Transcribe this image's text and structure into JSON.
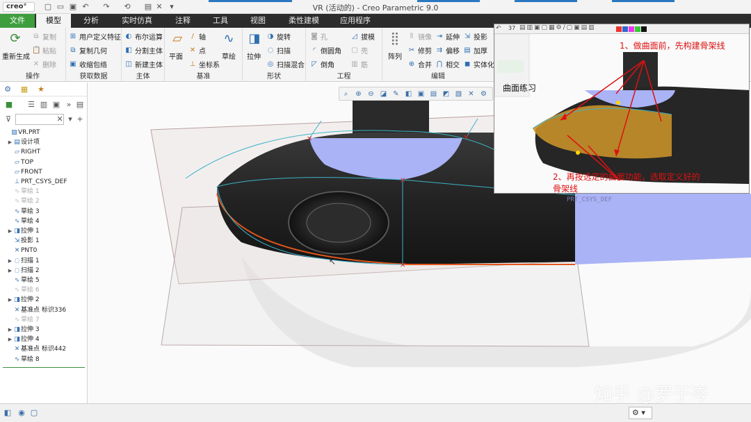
{
  "window": {
    "logo": "creo°",
    "title": "VR (活动的) - Creo Parametric 9.0"
  },
  "menu_tabs": [
    {
      "label": "文件",
      "active": false
    },
    {
      "label": "模型",
      "active": true
    },
    {
      "label": "分析"
    },
    {
      "label": "实时仿真"
    },
    {
      "label": "注释"
    },
    {
      "label": "工具"
    },
    {
      "label": "视图"
    },
    {
      "label": "柔性建模"
    },
    {
      "label": "应用程序"
    }
  ],
  "ribbon": {
    "operations": {
      "regen": "重新生成",
      "copy": "复制",
      "paste": "粘贴",
      "delete": "删除",
      "label": "操作"
    },
    "get_data": {
      "udf": "用户定义特征",
      "copy_geom": "复制几何",
      "shrinkwrap": "收缩包络",
      "label": "获取数据"
    },
    "body": {
      "boolean": "布尔运算",
      "split": "分割主体",
      "new_body": "新建主体",
      "label": "主体"
    },
    "datum": {
      "plane": "平面",
      "axis": "轴",
      "point": "点",
      "csys": "坐标系",
      "sketch": "草绘",
      "label": "基准"
    },
    "shapes": {
      "extrude": "拉伸",
      "revolve": "旋转",
      "sweep": "扫描",
      "swept_blend": "扫描混合",
      "label": "形状"
    },
    "engineering": {
      "hole": "孔",
      "round": "倒圆角",
      "chamfer": "倒角",
      "draft": "拔模",
      "shell": "壳",
      "rib": "筋",
      "label": "工程"
    },
    "editing": {
      "pattern": "阵列",
      "mirror": "镜像",
      "trim": "修剪",
      "merge": "合并",
      "extend": "延伸",
      "offset": "偏移",
      "intersect": "相交",
      "project": "投影",
      "thicken": "加厚",
      "solidify": "实体化",
      "label": "编辑"
    }
  },
  "model_tree": {
    "items": [
      {
        "label": "VR.PRT",
        "icon": "part-icon",
        "expandable": false,
        "suppressed": false,
        "indent": 0
      },
      {
        "label": "设计项",
        "icon": "design-items-icon",
        "expandable": true,
        "suppressed": false,
        "indent": 1
      },
      {
        "label": "RIGHT",
        "icon": "datum-plane-icon",
        "expandable": false,
        "suppressed": false,
        "indent": 1
      },
      {
        "label": "TOP",
        "icon": "datum-plane-icon",
        "expandable": false,
        "suppressed": false,
        "indent": 1
      },
      {
        "label": "FRONT",
        "icon": "datum-plane-icon",
        "expandable": false,
        "suppressed": false,
        "indent": 1
      },
      {
        "label": "PRT_CSYS_DEF",
        "icon": "csys-icon",
        "expandable": false,
        "suppressed": false,
        "indent": 1
      },
      {
        "label": "草绘 1",
        "icon": "sketch-icon",
        "expandable": false,
        "suppressed": true,
        "indent": 1
      },
      {
        "label": "草绘 2",
        "icon": "sketch-icon",
        "expandable": false,
        "suppressed": true,
        "indent": 1
      },
      {
        "label": "草绘 3",
        "icon": "sketch-icon",
        "expandable": false,
        "suppressed": false,
        "indent": 1
      },
      {
        "label": "草绘 4",
        "icon": "sketch-icon",
        "expandable": false,
        "suppressed": false,
        "indent": 1
      },
      {
        "label": "拉伸 1",
        "icon": "extrude-icon",
        "expandable": true,
        "suppressed": false,
        "indent": 1
      },
      {
        "label": "投影 1",
        "icon": "project-icon",
        "expandable": false,
        "suppressed": false,
        "indent": 1
      },
      {
        "label": "PNT0",
        "icon": "datum-point-icon",
        "expandable": false,
        "suppressed": false,
        "indent": 1
      },
      {
        "label": "扫描 1",
        "icon": "sweep-icon",
        "expandable": true,
        "suppressed": false,
        "indent": 1
      },
      {
        "label": "扫描 2",
        "icon": "sweep-icon",
        "expandable": true,
        "suppressed": false,
        "indent": 1
      },
      {
        "label": "草绘 5",
        "icon": "sketch-icon",
        "expandable": false,
        "suppressed": false,
        "indent": 1
      },
      {
        "label": "草绘 6",
        "icon": "sketch-icon",
        "expandable": false,
        "suppressed": true,
        "indent": 1
      },
      {
        "label": "拉伸 2",
        "icon": "extrude-icon",
        "expandable": true,
        "suppressed": false,
        "indent": 1
      },
      {
        "label": "基准点 标识336",
        "icon": "datum-point-icon",
        "expandable": false,
        "suppressed": false,
        "indent": 1
      },
      {
        "label": "草绘 7",
        "icon": "sketch-icon",
        "expandable": false,
        "suppressed": true,
        "indent": 1
      },
      {
        "label": "拉伸 3",
        "icon": "extrude-icon",
        "expandable": true,
        "suppressed": false,
        "indent": 1
      },
      {
        "label": "拉伸 4",
        "icon": "extrude-icon",
        "expandable": true,
        "suppressed": false,
        "indent": 1
      },
      {
        "label": "基准点 标识442",
        "icon": "datum-point-icon",
        "expandable": false,
        "suppressed": false,
        "indent": 1
      },
      {
        "label": "草绘 8",
        "icon": "sketch-icon",
        "expandable": false,
        "suppressed": false,
        "indent": 1
      }
    ]
  },
  "viewport": {
    "csys_label": "PRT_CSYS_DEF",
    "colors": {
      "surface": "#aab3f5",
      "edge": "#e2571c",
      "curve": "#3cb4c8",
      "point": "#cc2222"
    }
  },
  "inset": {
    "toolbar_number": "37",
    "title": "曲面练习",
    "note1": "1、做曲面前，先构建骨架线",
    "note2_line1": "2、再按选定的曲面功能，选取定义好的",
    "note2_line2": "骨架线"
  },
  "watermark": "知乎 @罗于岑"
}
